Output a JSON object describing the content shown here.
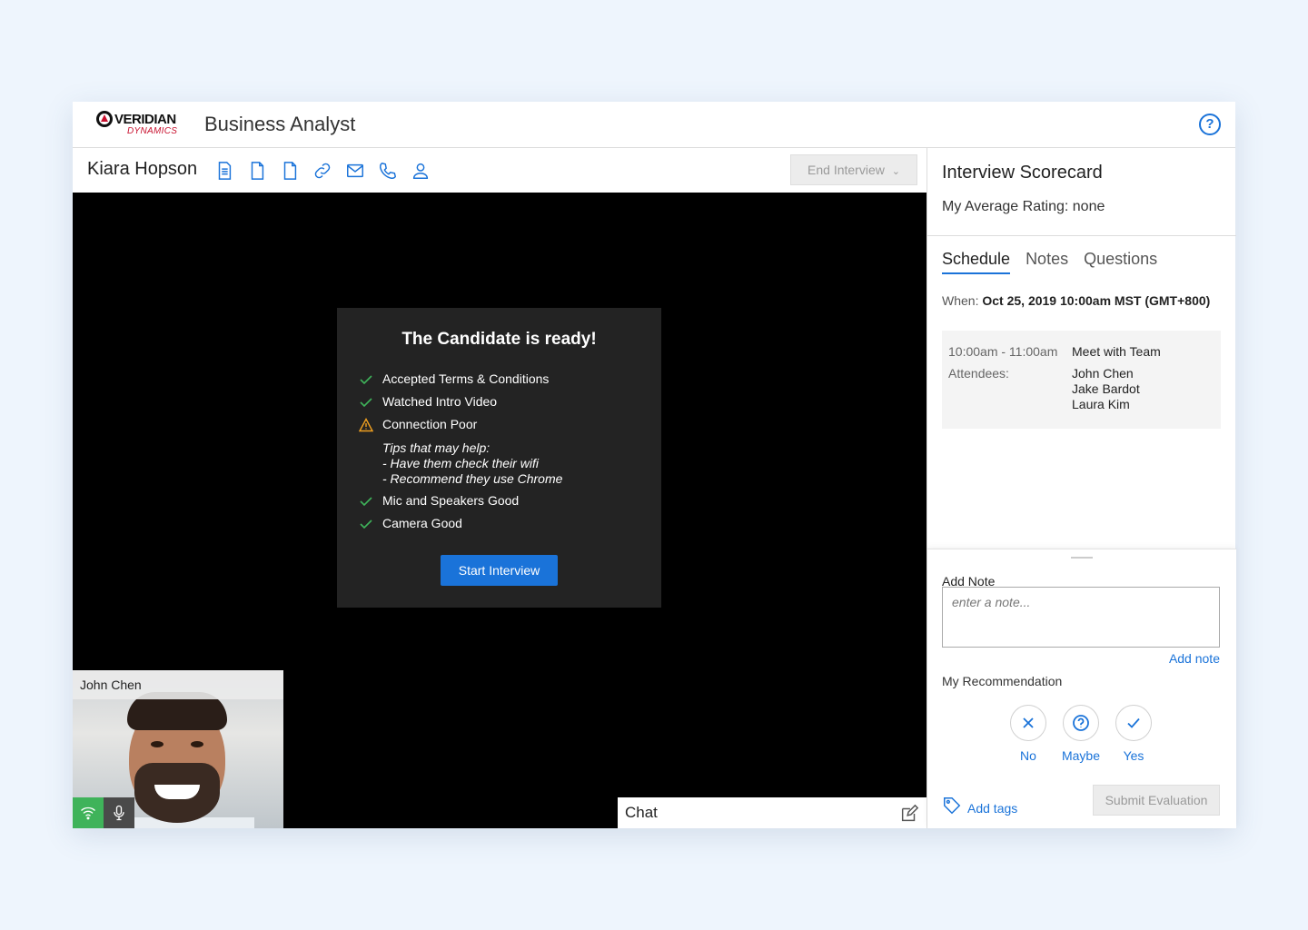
{
  "header": {
    "brand_name": "VERIDIAN",
    "brand_sub": "DYNAMICS",
    "job_title": "Business Analyst",
    "help_icon": "help-circle-icon"
  },
  "candidate": {
    "name": "Kiara Hopson",
    "icons": [
      "resume-icon",
      "document-icon",
      "document-icon",
      "link-icon",
      "email-icon",
      "phone-icon",
      "profile-icon"
    ],
    "end_interview_label": "End Interview",
    "end_interview_chevron": "⌄"
  },
  "ready_card": {
    "title": "The Candidate is ready!",
    "checks": [
      {
        "label": "Accepted Terms & Conditions",
        "status": "ok"
      },
      {
        "label": "Watched Intro Video",
        "status": "ok"
      },
      {
        "label": "Connection Poor",
        "status": "warning"
      }
    ],
    "tips": {
      "heading": "Tips that may help:",
      "line1": "- Have them check their wifi",
      "line2": "- Recommend they use Chrome"
    },
    "checks_after": [
      {
        "label": "Mic and Speakers Good",
        "status": "ok"
      },
      {
        "label": "Camera Good",
        "status": "ok"
      }
    ],
    "start_label": "Start Interview",
    "colors": {
      "ok": "#3fb35a",
      "warning": "#f0a020"
    }
  },
  "self_view": {
    "name": "John Chen"
  },
  "chat": {
    "label": "Chat"
  },
  "scorecard": {
    "title": "Interview Scorecard",
    "avg_rating": "My Average Rating: none",
    "tabs": [
      "Schedule",
      "Notes",
      "Questions"
    ],
    "active_tab": "Schedule",
    "when_label": "When:",
    "when_value": "Oct 25, 2019 10:00am MST (GMT+800)",
    "schedule": {
      "time": "10:00am - 11:00am",
      "event": "Meet with Team",
      "attendees_label": "Attendees:",
      "attendees": [
        "John Chen",
        "Jake Bardot",
        "Laura Kim"
      ]
    }
  },
  "note_panel": {
    "add_note_label": "Add Note",
    "note_placeholder": "enter a note...",
    "add_note_link": "Add note",
    "recommendation_label": "My Recommendation",
    "options": [
      "No",
      "Maybe",
      "Yes"
    ],
    "add_tags_label": "Add tags",
    "submit_label": "Submit Evaluation"
  },
  "colors": {
    "accent": "#1a73d9",
    "video_bg": "#000000",
    "card_bg": "#232323",
    "page_bg": "#eef5fd"
  }
}
